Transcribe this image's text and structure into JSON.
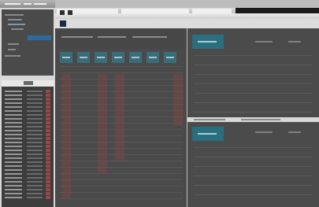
{
  "colors": {
    "sidebar_bg": "#d8d8d8",
    "panel_dark": "#4a4a4a",
    "accent_teal": "#2a6f7f",
    "selection_blue": "#2d6aa2",
    "red_highlight": "#b24a4a"
  },
  "layout_notes": [],
  "ui": {}
}
